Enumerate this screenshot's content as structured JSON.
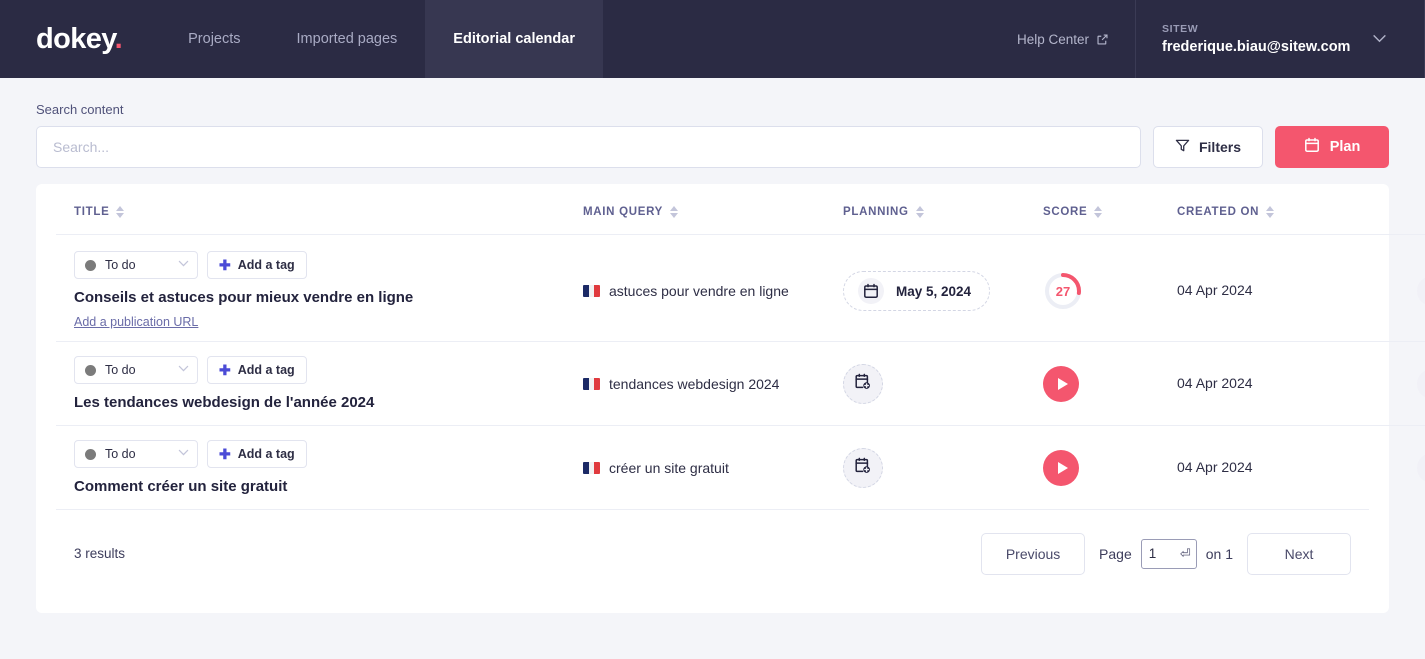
{
  "brand": {
    "name": "dokey",
    "dot": ".",
    "accent": "#f4566e",
    "nav_bg": "#2b2b44",
    "nav_active_bg": "#373751"
  },
  "nav": {
    "links": [
      {
        "label": "Projects",
        "active": false
      },
      {
        "label": "Imported pages",
        "active": false
      },
      {
        "label": "Editorial calendar",
        "active": true
      }
    ],
    "help_center": "Help Center",
    "account": {
      "org": "SITEW",
      "email": "frederique.biau@sitew.com"
    }
  },
  "search": {
    "label": "Search content",
    "placeholder": "Search...",
    "value": "",
    "filters_label": "Filters",
    "plan_label": "Plan"
  },
  "table": {
    "columns": [
      {
        "label": "TITLE"
      },
      {
        "label": "MAIN QUERY"
      },
      {
        "label": "PLANNING"
      },
      {
        "label": "SCORE"
      },
      {
        "label": "CREATED ON"
      }
    ],
    "status_label": "To do",
    "status_color": "#7b7b7b",
    "add_tag_label": "Add a tag",
    "add_url_label": "Add a publication URL",
    "rows": [
      {
        "status": "To do",
        "tag": "Add a tag",
        "title": "Conseils et astuces pour mieux vendre en ligne",
        "publication_url_label": "Add a publication URL",
        "query": "astuces pour vendre en ligne",
        "query_flag": "fr",
        "planning_type": "dated",
        "planning": "May 5, 2024",
        "score_type": "value",
        "score": 27,
        "score_max": 100,
        "created_on": "04 Apr 2024"
      },
      {
        "status": "To do",
        "tag": "Add a tag",
        "title": "Les tendances webdesign de l'année 2024",
        "publication_url_label": "",
        "query": "tendances webdesign 2024",
        "query_flag": "fr",
        "planning_type": "empty",
        "planning": "",
        "score_type": "play",
        "score": null,
        "score_max": 100,
        "created_on": "04 Apr 2024"
      },
      {
        "status": "To do",
        "tag": "Add a tag",
        "title": "Comment créer un site gratuit",
        "publication_url_label": "",
        "query": "créer un site gratuit",
        "query_flag": "fr",
        "planning_type": "empty",
        "planning": "",
        "score_type": "play",
        "score": null,
        "score_max": 100,
        "created_on": "04 Apr 2024"
      }
    ]
  },
  "footer": {
    "results": "3 results",
    "previous": "Previous",
    "next": "Next",
    "page_word": "Page",
    "page_value": "1",
    "on_word": "on 1"
  },
  "icons": {
    "external_link": "external-link-icon",
    "filter": "filter-icon",
    "calendar": "calendar-icon",
    "calendar_plus": "calendar-plus-icon",
    "chevron_down": "chevron-down-icon",
    "kebab": "kebab-menu-icon",
    "enter": "enter-key-icon"
  }
}
